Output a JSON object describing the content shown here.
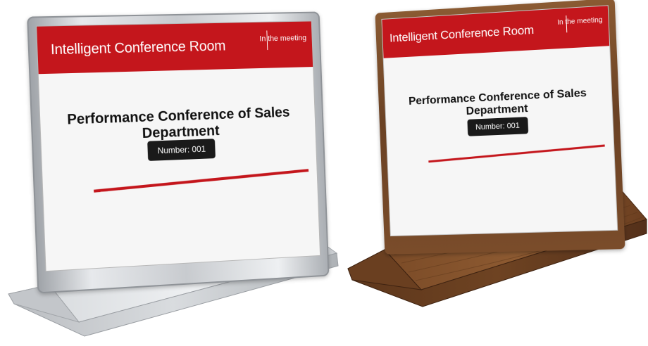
{
  "signs": [
    {
      "finish": "silver",
      "header_title": "Intelligent Conference Room",
      "status": "In the meeting",
      "meeting_title": "Performance Conference of Sales Department",
      "number_label": "Number: 001"
    },
    {
      "finish": "wood",
      "header_title": "Intelligent Conference Room",
      "status": "In the meeting",
      "meeting_title": "Performance Conference of Sales Department",
      "number_label": "Number: 001"
    }
  ],
  "colors": {
    "banner_red": "#c4161c",
    "badge_dark": "#1a1a1a",
    "silver": "#cfd2d6",
    "wood": "#6b4224"
  }
}
